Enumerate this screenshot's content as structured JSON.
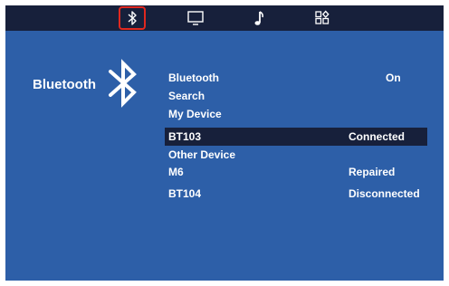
{
  "tabs": [
    {
      "icon": "bluetooth-icon",
      "selected": true
    },
    {
      "icon": "monitor-icon",
      "selected": false
    },
    {
      "icon": "music-note-icon",
      "selected": false
    },
    {
      "icon": "apps-grid-icon",
      "selected": false
    }
  ],
  "section_title": "Bluetooth",
  "settings": {
    "bluetooth": {
      "label": "Bluetooth",
      "value": "On"
    },
    "search": {
      "label": "Search"
    },
    "my_device_header": "My Device",
    "other_device_header": "Other Device"
  },
  "my_devices": [
    {
      "name": "BT103",
      "status": "Connected",
      "highlighted": true
    }
  ],
  "other_devices": [
    {
      "name": "M6",
      "status": "Repaired"
    },
    {
      "name": "BT104",
      "status": "Disconnected"
    }
  ],
  "colors": {
    "background": "#2d5fa8",
    "bar": "#17203b",
    "selection_outline": "#e0281f",
    "text": "#ffffff"
  }
}
